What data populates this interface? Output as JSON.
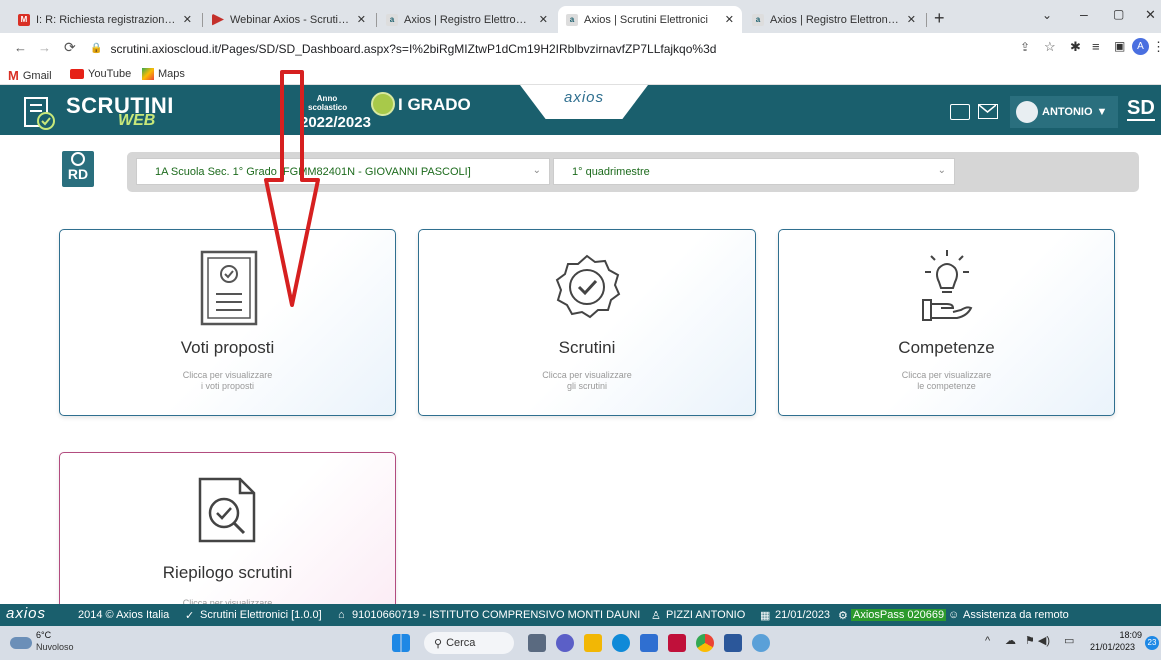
{
  "browser": {
    "tabs": [
      {
        "label": "I: R: Richiesta registrazione webin",
        "icon": "gmail-icon",
        "color": "#d93025"
      },
      {
        "label": "Webinar Axios - Scrutini Scuola P",
        "icon": "youtube-icon",
        "color": "#c4302b"
      },
      {
        "label": "Axios | Registro Elettronico Docen",
        "icon": "axios-icon",
        "color": "#1a5f6d"
      },
      {
        "label": "Axios | Scrutini Elettronici",
        "icon": "axios-icon",
        "color": "#1a5f6d"
      },
      {
        "label": "Axios | Registro Elettronico Docen",
        "icon": "axios-icon",
        "color": "#1a5f6d"
      }
    ],
    "new_tab": "+",
    "url": "scrutini.axioscloud.it/Pages/SD/SD_Dashboard.aspx?s=I%2biRgMIZtwP1dCm19H2IRblbvzirnavfZP7LLfajkqo%3d",
    "bookmarks": [
      "Gmail",
      "YouTube",
      "Maps"
    ],
    "profile_initial": "A"
  },
  "header": {
    "brand_main": "SCRUTINI",
    "brand_sub": "WEB",
    "anno_label": "Anno scolastico",
    "anno_value": "2022/2023",
    "grado": "I GRADO",
    "axios_logo": "axios",
    "user": "ANTONIO",
    "initials": "SD"
  },
  "filters": {
    "rd_label": "RD",
    "school": "1A Scuola Sec. 1° Grado [FGMM82401N - GIOVANNI PASCOLI]",
    "period": "1° quadrimestre"
  },
  "cards": [
    {
      "title": "Voti proposti",
      "sub1": "Clicca per visualizzare",
      "sub2": "i voti proposti"
    },
    {
      "title": "Scrutini",
      "sub1": "Clicca per visualizzare",
      "sub2": "gli scrutini"
    },
    {
      "title": "Competenze",
      "sub1": "Clicca per visualizzare",
      "sub2": "le competenze"
    },
    {
      "title": "Riepilogo scrutini",
      "sub1": "Clicca per visualizzare",
      "sub2": ""
    }
  ],
  "footer": {
    "brand": "axios",
    "copyright": "2014 © Axios Italia",
    "app": "Scrutini Elettronici [1.0.0]",
    "school": "91010660719 - ISTITUTO COMPRENSIVO MONTI DAUNI",
    "user": "PIZZI ANTONIO",
    "date": "21/01/2023",
    "axiospass": "AxiosPass 020669",
    "assistenza": "Assistenza da remoto"
  },
  "taskbar": {
    "weather_temp": "6°C",
    "weather_desc": "Nuvoloso",
    "search": "Cerca",
    "time": "18:09",
    "date": "21/01/2023",
    "notif": "23"
  },
  "colors": {
    "header": "#1a5f6d",
    "card_border": "#2f6f8f",
    "card_pink": "#b24c7f",
    "arrow": "#d62020"
  }
}
